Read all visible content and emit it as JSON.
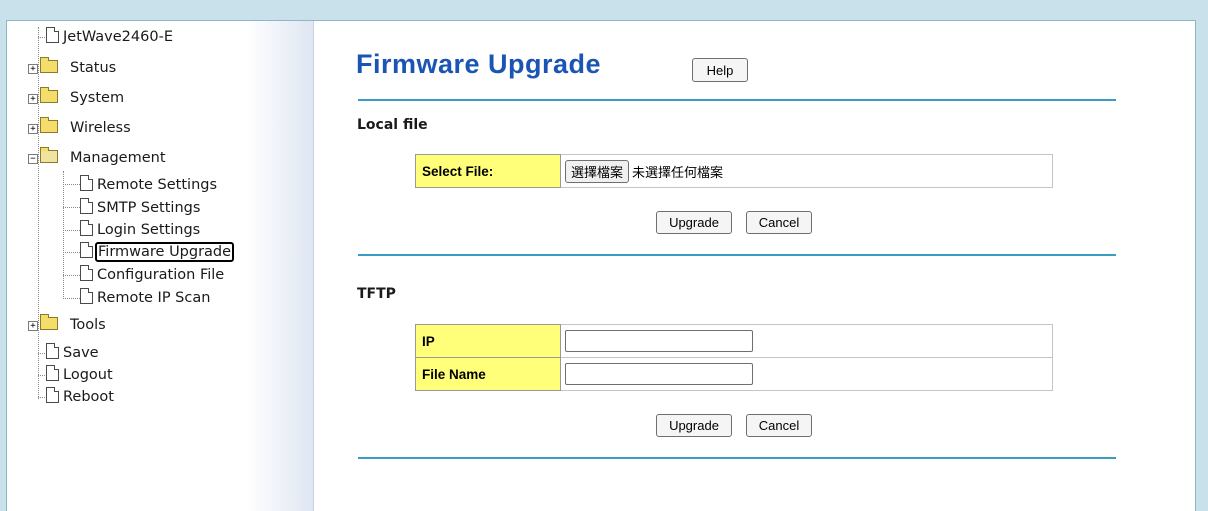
{
  "sidebar": {
    "root": "JetWave2460-E",
    "folders": {
      "status": "Status",
      "system": "System",
      "wireless": "Wireless",
      "management": "Management",
      "tools": "Tools"
    },
    "management_items": {
      "remote_settings": "Remote Settings",
      "smtp_settings": "SMTP Settings",
      "login_settings": "Login Settings",
      "firmware_upgrade": "Firmware Upgrade",
      "configuration_file": "Configuration File",
      "remote_ip_scan": "Remote IP Scan"
    },
    "actions": {
      "save": "Save",
      "logout": "Logout",
      "reboot": "Reboot"
    },
    "expand_symbol": "+",
    "collapse_symbol": "−"
  },
  "main": {
    "title": "Firmware Upgrade",
    "help_label": "Help",
    "local": {
      "section_title": "Local file",
      "select_file_label": "Select File:",
      "choose_button": "選擇檔案",
      "no_file_text": "未選擇任何檔案",
      "upgrade_label": "Upgrade",
      "cancel_label": "Cancel"
    },
    "tftp": {
      "section_title": "TFTP",
      "ip_label": "IP",
      "ip_value": "",
      "filename_label": "File Name",
      "filename_value": "",
      "upgrade_label": "Upgrade",
      "cancel_label": "Cancel"
    }
  },
  "colors": {
    "title": "#1b55b4",
    "label_bg": "#ffff7a",
    "divider": "#3a9cc4",
    "page_bg": "#c9e1ea"
  }
}
